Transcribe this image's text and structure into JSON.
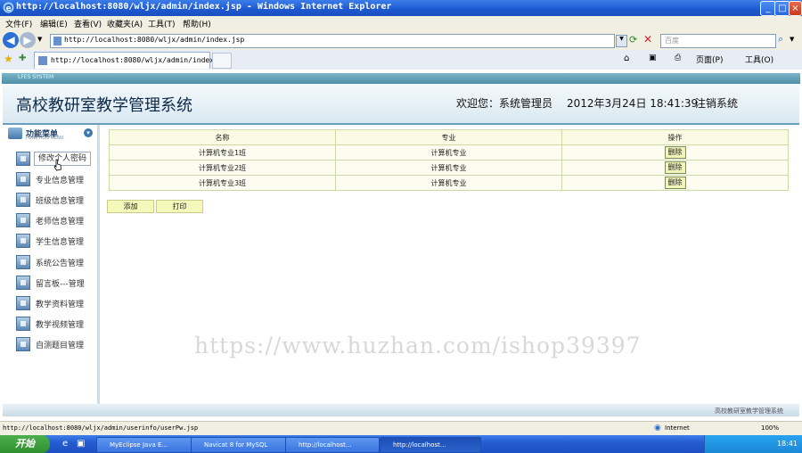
{
  "window": {
    "title": "http://localhost:8080/wljx/admin/index.jsp - Windows Internet Explorer"
  },
  "menu": [
    "文件(F)",
    "编辑(E)",
    "查看(V)",
    "收藏夹(A)",
    "工具(T)",
    "帮助(H)"
  ],
  "address": {
    "url": "http://localhost:8080/wljx/admin/index.jsp",
    "search_placeholder": "百度"
  },
  "tab": {
    "title": "http://localhost:8080/wljx/admin/index.jsp"
  },
  "toolbar": {
    "page": "页面(P)",
    "tools": "工具(O)"
  },
  "frame_strip": "LFES SYSTEM",
  "header": {
    "title": "高校教研室教学管理系统",
    "welcome": "欢迎您：系统管理员",
    "datetime": "2012年3月24日  18:41:39",
    "logout": "注销系统"
  },
  "sidebar": {
    "title": "功能菜单",
    "subtitle": "FUNCTION MENU",
    "items": [
      {
        "label": "修改个人密码"
      },
      {
        "label": "专业信息管理"
      },
      {
        "label": "班级信息管理"
      },
      {
        "label": "老师信息管理"
      },
      {
        "label": "学生信息管理"
      },
      {
        "label": "系统公告管理"
      },
      {
        "label": "留言板---管理"
      },
      {
        "label": "教学资料管理"
      },
      {
        "label": "教学视频管理"
      },
      {
        "label": "自测题目管理"
      }
    ]
  },
  "table": {
    "headers": [
      "名称",
      "专业",
      "操作"
    ],
    "rows": [
      {
        "name": "计算机专业1班",
        "major": "计算机专业",
        "action": "删除"
      },
      {
        "name": "计算机专业2班",
        "major": "计算机专业",
        "action": "删除"
      },
      {
        "name": "计算机专业3班",
        "major": "计算机专业",
        "action": "删除"
      }
    ]
  },
  "buttons": {
    "add": "添加",
    "print": "打印"
  },
  "watermark": "https://www.huzhan.com/ishop39397",
  "footer": "高校教研室教学管理系统",
  "status": {
    "url": "http://localhost:8080/wljx/admin/userinfo/userPw.jsp",
    "zone": "Internet",
    "zoom": "100%"
  },
  "taskbar": {
    "start": "开始",
    "tasks": [
      "MyEclipse Java E...",
      "Navicat 8 for MySQL",
      "http://localhost...",
      "http://localhost..."
    ],
    "clock": "18:41"
  }
}
